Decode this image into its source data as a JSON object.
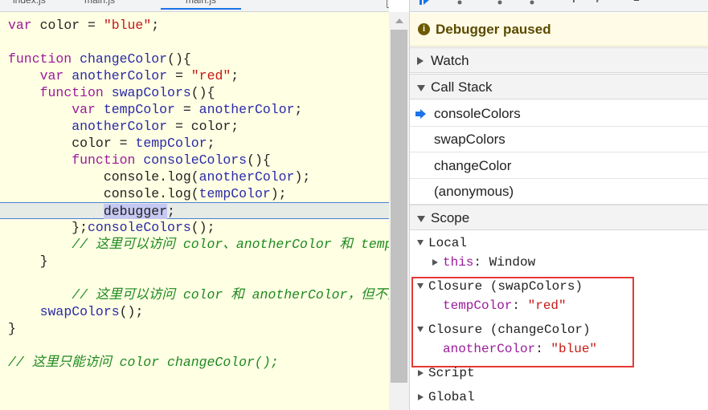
{
  "editor": {
    "tabs": [
      "index.js",
      "main.js",
      "main.js"
    ],
    "code": [
      [
        [
          "kw",
          "var "
        ],
        [
          "",
          "color = "
        ],
        [
          "str",
          "\"blue\""
        ],
        [
          "",
          ";"
        ]
      ],
      [],
      [
        [
          "kw",
          "function "
        ],
        [
          "fn",
          "changeColor"
        ],
        [
          "",
          "(){"
        ]
      ],
      [
        [
          "",
          "    "
        ],
        [
          "kw",
          "var "
        ],
        [
          "fn",
          "anotherColor"
        ],
        [
          "",
          " = "
        ],
        [
          "str",
          "\"red\""
        ],
        [
          "",
          ";"
        ]
      ],
      [
        [
          "",
          "    "
        ],
        [
          "kw",
          "function "
        ],
        [
          "fn",
          "swapColors"
        ],
        [
          "",
          "(){"
        ]
      ],
      [
        [
          "",
          "        "
        ],
        [
          "kw",
          "var "
        ],
        [
          "fn",
          "tempColor"
        ],
        [
          "",
          " = "
        ],
        [
          "fn",
          "anotherColor"
        ],
        [
          "",
          ";"
        ]
      ],
      [
        [
          "",
          "        "
        ],
        [
          "fn",
          "anotherColor"
        ],
        [
          "",
          " = color;"
        ]
      ],
      [
        [
          "",
          "        color = "
        ],
        [
          "fn",
          "tempColor"
        ],
        [
          "",
          ";"
        ]
      ],
      [
        [
          "",
          "        "
        ],
        [
          "kw",
          "function "
        ],
        [
          "fn",
          "consoleColors"
        ],
        [
          "",
          "(){"
        ]
      ],
      [
        [
          "",
          "            console.log("
        ],
        [
          "fn",
          "anotherColor"
        ],
        [
          "",
          ");"
        ]
      ],
      [
        [
          "",
          "            console.log("
        ],
        [
          "fn",
          "tempColor"
        ],
        [
          "",
          ");"
        ]
      ],
      [
        [
          "",
          "            "
        ],
        [
          "hl",
          "debugger"
        ],
        [
          "",
          ";"
        ]
      ],
      [
        [
          "",
          "        };"
        ],
        [
          "fn",
          "consoleColors"
        ],
        [
          "",
          "();"
        ]
      ],
      [
        [
          "",
          "        "
        ],
        [
          "cmt",
          "// 这里可以访问 color、anotherColor 和 tempColor"
        ]
      ],
      [
        [
          "",
          "    }"
        ]
      ],
      [],
      [
        [
          "",
          "        "
        ],
        [
          "cmt",
          "// 这里可以访问 color 和 anotherColor，但不能访问 tempColor"
        ]
      ],
      [
        [
          "",
          "    "
        ],
        [
          "fn",
          "swapColors"
        ],
        [
          "",
          "();"
        ]
      ],
      [
        [
          "",
          "}"
        ]
      ],
      [],
      [
        [
          "cmt",
          "// 这里只能访问 color changeColor();"
        ]
      ]
    ]
  },
  "debugger": {
    "paused_text": "Debugger paused",
    "watch_label": "Watch",
    "callstack_label": "Call Stack",
    "frames": [
      "consoleColors",
      "swapColors",
      "changeColor",
      "(anonymous)"
    ],
    "scope_label": "Scope",
    "scope": {
      "local_label": "Local",
      "this_key": "this",
      "this_value": "Window",
      "closure1_label": "Closure (swapColors)",
      "closure1_key": "tempColor",
      "closure1_value": "\"red\"",
      "closure2_label": "Closure (changeColor)",
      "closure2_key": "anotherColor",
      "closure2_value": "\"blue\"",
      "script_label": "Script",
      "global_label": "Global"
    },
    "highlight_color": "#e53935"
  }
}
